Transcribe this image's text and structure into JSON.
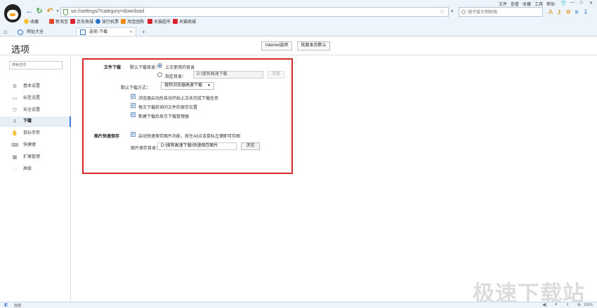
{
  "browser": {
    "top_menu": [
      "文件",
      "查看",
      "收藏",
      "工具",
      "帮助"
    ],
    "address_url": "se://settings/?category=download",
    "search_placeholder": "骑子废大侧助侮",
    "bookmarks": [
      {
        "label": "收藏",
        "color": "#f1c232"
      },
      {
        "label": "新淘宝",
        "color": "#e8462b"
      },
      {
        "label": "京东商城",
        "color": "#d9232d"
      },
      {
        "label": "旅行机票",
        "color": "#2a72c9"
      },
      {
        "label": "淘宝团购",
        "color": "#f08a18"
      },
      {
        "label": "天猫超市",
        "color": "#d9232d"
      },
      {
        "label": "天猫商城",
        "color": "#d9232d"
      }
    ],
    "tabs": [
      {
        "label": "网址大全",
        "active": false
      },
      {
        "label": "选项-下载",
        "active": true
      }
    ],
    "new_tab_label": "+"
  },
  "page": {
    "title": "选项",
    "internet_options_label": "Internet选项",
    "restore_defaults_label": "恢复本页默认"
  },
  "sidebar": {
    "search_placeholder": "搜索选项",
    "items": [
      {
        "label": "基本设置",
        "icon": "gear-icon",
        "glyph": "⚙",
        "active": false
      },
      {
        "label": "标签设置",
        "icon": "tab-icon",
        "glyph": "▭",
        "active": false
      },
      {
        "label": "安全设置",
        "icon": "shield-icon",
        "glyph": "⛉",
        "active": false
      },
      {
        "label": "下载",
        "icon": "download-icon",
        "glyph": "⇩",
        "active": true
      },
      {
        "label": "鼠标手势",
        "icon": "mouse-gesture-icon",
        "glyph": "✋",
        "active": false
      },
      {
        "label": "快捷键",
        "icon": "keyboard-icon",
        "glyph": "⌨",
        "active": false
      },
      {
        "label": "扩展管理",
        "icon": "extension-icon",
        "glyph": "▦",
        "active": false
      },
      {
        "label": "高级",
        "icon": "more-icon",
        "glyph": "···",
        "active": false
      }
    ]
  },
  "download": {
    "section_title": "文件下载",
    "default_dir_label": "默认下载目录：",
    "radio_last_used": "上次使用的目录",
    "radio_specified": "指定目录：",
    "specified_path": "D:\\搜狗高速下载",
    "browse_label": "浏览",
    "default_method_label": "默认下载方式：",
    "default_method_value": "搜狗浏览器高速下载",
    "checkboxes": [
      "浏览器启动后自动开始上次未完成下载任务",
      "每次下载前询问文件的保存位置",
      "新建下载后显示下载管理器"
    ]
  },
  "image_save": {
    "section_title": "图片快速保存",
    "checkbox": "启动快速保存图片功能，按住Alt点击鼠标左键即可存图",
    "dir_label": "图片保存目录：",
    "dir_value": "D:\\搜狗高速下载\\快速保存图片",
    "browse_label": "浏览"
  },
  "watermark": "极速下载站",
  "status": {
    "text": "完成",
    "zoom": "100%"
  }
}
